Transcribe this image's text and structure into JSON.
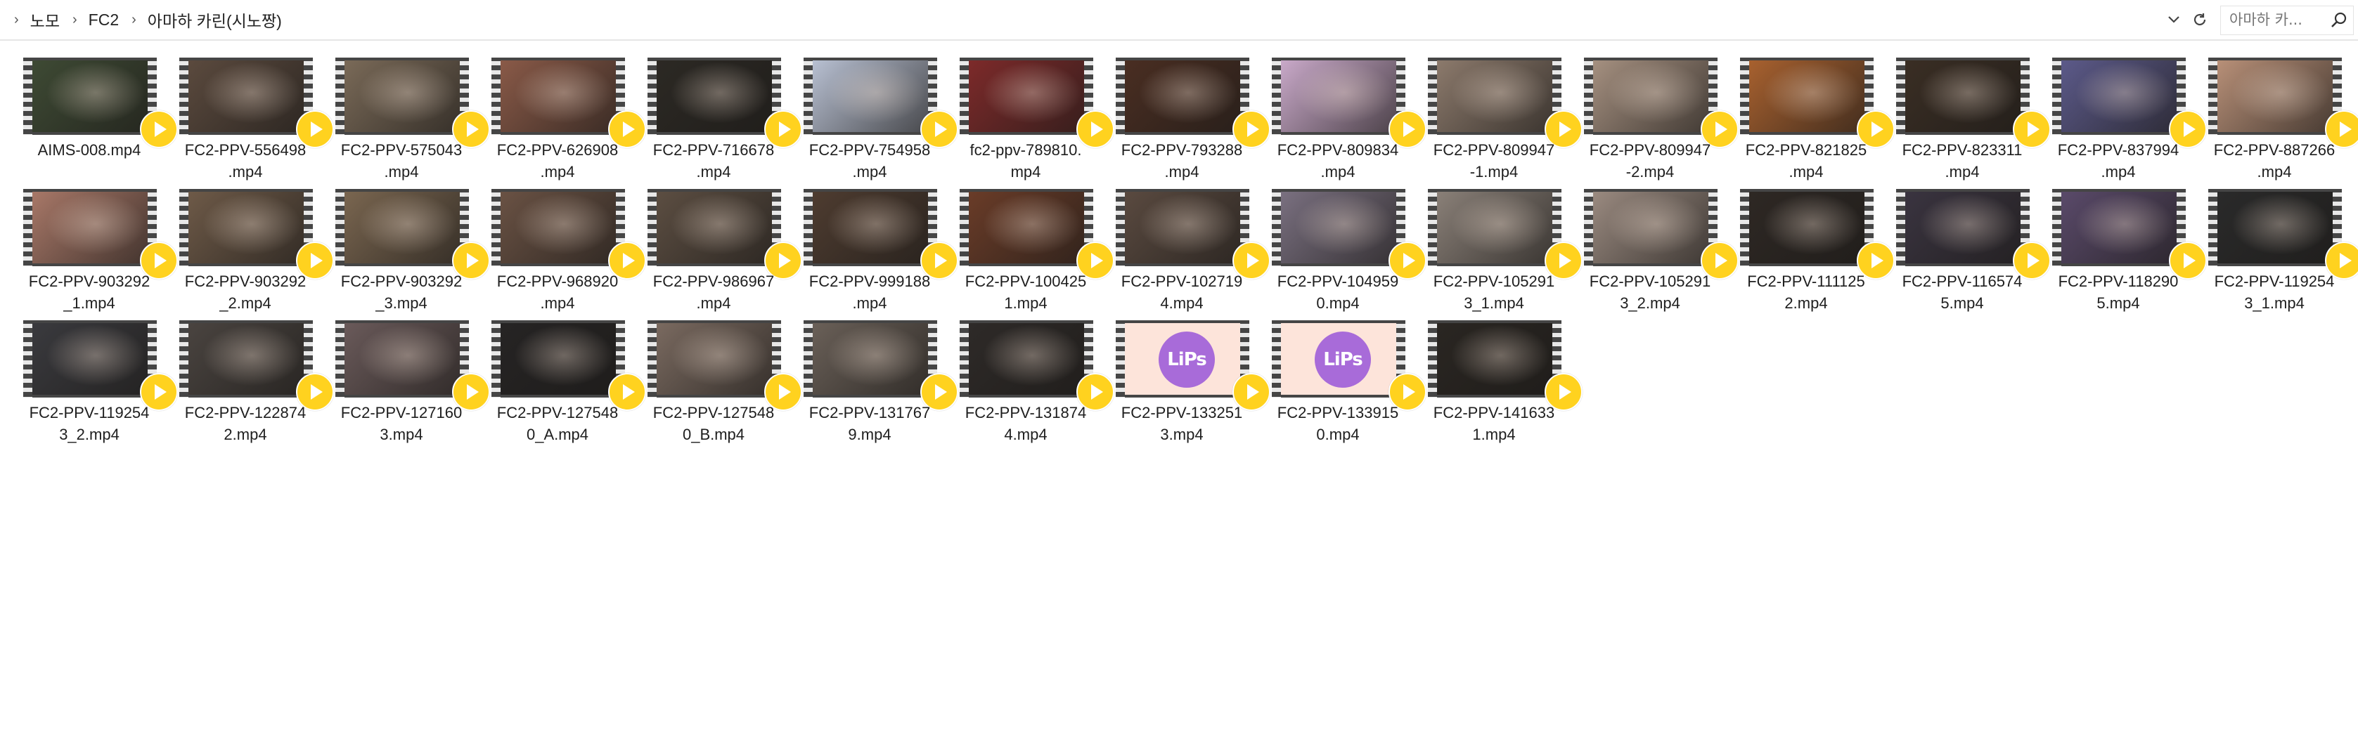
{
  "breadcrumb": {
    "items": [
      "노모",
      "FC2",
      "아마하 카린(시노짱)"
    ]
  },
  "search": {
    "placeholder": "아마하 카..."
  },
  "colors": {
    "play_badge": "#ffd21f",
    "film_strip": "#454545",
    "lips_logo": "#a86bd9",
    "lips_bg": "#fde4da"
  },
  "files": [
    {
      "name": "AIMS-008.mp4",
      "thumb": "#3e4a34"
    },
    {
      "name": "FC2-PPV-556498\n.mp4",
      "thumb": "#5b4a3e"
    },
    {
      "name": "FC2-PPV-575043\n.mp4",
      "thumb": "#7a6a58"
    },
    {
      "name": "FC2-PPV-626908\n.mp4",
      "thumb": "#8a5a48"
    },
    {
      "name": "FC2-PPV-716678\n.mp4",
      "thumb": "#2c2924"
    },
    {
      "name": "FC2-PPV-754958\n.mp4",
      "thumb": "#b8c0d2"
    },
    {
      "name": "fc2-ppv-789810.\nmp4",
      "thumb": "#7d2a2a"
    },
    {
      "name": "FC2-PPV-793288\n.mp4",
      "thumb": "#4a2e22"
    },
    {
      "name": "FC2-PPV-809834\n.mp4",
      "thumb": "#c9a9c9"
    },
    {
      "name": "FC2-PPV-809947\n-1.mp4",
      "thumb": "#8c7a6c"
    },
    {
      "name": "FC2-PPV-809947\n-2.mp4",
      "thumb": "#a59080"
    },
    {
      "name": "FC2-PPV-821825\n.mp4",
      "thumb": "#a8612f"
    },
    {
      "name": "FC2-PPV-823311\n.mp4",
      "thumb": "#3a2e24"
    },
    {
      "name": "FC2-PPV-837994\n.mp4",
      "thumb": "#5c5a8a"
    },
    {
      "name": "FC2-PPV-887266\n.mp4",
      "thumb": "#b89078"
    },
    {
      "name": "FC2-PPV-903292\n_1.mp4",
      "thumb": "#a87868"
    },
    {
      "name": "FC2-PPV-903292\n_2.mp4",
      "thumb": "#6e5a48"
    },
    {
      "name": "FC2-PPV-903292\n_3.mp4",
      "thumb": "#7a6650"
    },
    {
      "name": "FC2-PPV-968920\n.mp4",
      "thumb": "#6a5244"
    },
    {
      "name": "FC2-PPV-986967\n.mp4",
      "thumb": "#5c4e42"
    },
    {
      "name": "FC2-PPV-999188\n.mp4",
      "thumb": "#4e3c30"
    },
    {
      "name": "FC2-PPV-100425\n1.mp4",
      "thumb": "#6a3c28"
    },
    {
      "name": "FC2-PPV-102719\n4.mp4",
      "thumb": "#5a4a40"
    },
    {
      "name": "FC2-PPV-104959\n0.mp4",
      "thumb": "#7a7080"
    },
    {
      "name": "FC2-PPV-105291\n3_1.mp4",
      "thumb": "#8a8078"
    },
    {
      "name": "FC2-PPV-105291\n3_2.mp4",
      "thumb": "#9a8a80"
    },
    {
      "name": "FC2-PPV-111125\n2.mp4",
      "thumb": "#2e2824"
    },
    {
      "name": "FC2-PPV-116574\n5.mp4",
      "thumb": "#3a3440"
    },
    {
      "name": "FC2-PPV-118290\n5.mp4",
      "thumb": "#5a4a6a"
    },
    {
      "name": "FC2-PPV-119254\n3_1.mp4",
      "thumb": "#2a2a2a"
    },
    {
      "name": "FC2-PPV-119254\n3_2.mp4",
      "thumb": "#3a3a3e"
    },
    {
      "name": "FC2-PPV-122874\n2.mp4",
      "thumb": "#4a4440"
    },
    {
      "name": "FC2-PPV-127160\n3.mp4",
      "thumb": "#6a5a5a"
    },
    {
      "name": "FC2-PPV-127548\n0_A.mp4",
      "thumb": "#262424"
    },
    {
      "name": "FC2-PPV-127548\n0_B.mp4",
      "thumb": "#7a6a60"
    },
    {
      "name": "FC2-PPV-131767\n9.mp4",
      "thumb": "#6a6058"
    },
    {
      "name": "FC2-PPV-131874\n4.mp4",
      "thumb": "#2e2a28"
    },
    {
      "name": "FC2-PPV-133251\n3.mp4",
      "thumb": "lips",
      "logo": "LiPs"
    },
    {
      "name": "FC2-PPV-133915\n0.mp4",
      "thumb": "lips",
      "logo": "LiPs"
    },
    {
      "name": "FC2-PPV-141633\n1.mp4",
      "thumb": "#2a2622"
    }
  ]
}
